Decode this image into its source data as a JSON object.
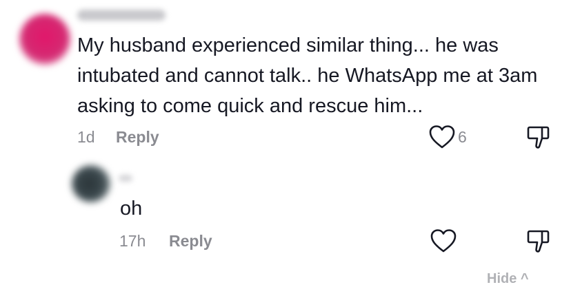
{
  "comments": [
    {
      "avatar_color": "#e2166a",
      "text": "My husband experienced similar thing... he was intubated and cannot talk.. he WhatsApp me at 3am asking to come quick and rescue him...",
      "time": "1d",
      "reply_label": "Reply",
      "like_count": "6"
    },
    {
      "avatar_color": "#2a3438",
      "text": "oh",
      "time": "17h",
      "reply_label": "Reply",
      "like_count": ""
    }
  ],
  "hide_label": "Hide ^",
  "icons": {
    "like": "heart-outline-icon",
    "dislike": "thumbs-down-outline-icon"
  },
  "colors": {
    "text": "#161823",
    "muted": "#8a8b91",
    "icon": "#161823"
  }
}
